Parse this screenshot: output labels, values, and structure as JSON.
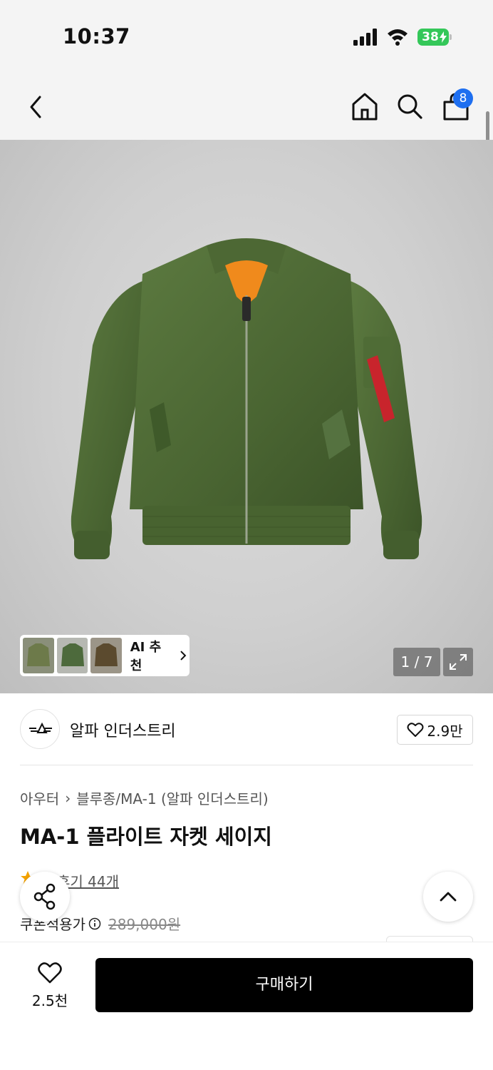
{
  "status_bar": {
    "time": "10:37",
    "battery": "38"
  },
  "nav": {
    "cart_count": "8"
  },
  "gallery": {
    "thumbnails": [
      "thumb-olive",
      "thumb-green",
      "thumb-brown"
    ],
    "ai_label": "AI 추천",
    "page_counter": "1 / 7"
  },
  "brand": {
    "name": "알파 인더스트리",
    "likes": "2.9만"
  },
  "product": {
    "breadcrumb": [
      "아우터",
      "블루종/MA-1 (알파 인더스트리)"
    ],
    "title": "MA-1 플라이트 자켓 세이지",
    "review": "후기 44개",
    "price_label": "쿠폰적용가",
    "original_price": "289,000원"
  },
  "bottom_bar": {
    "like_count": "2.5천",
    "buy_label": "구매하기"
  },
  "colors": {
    "accent": "#1e6ff0",
    "jacket": "#4e6a36",
    "lining": "#f08a1c",
    "buy_button": "#000000"
  }
}
